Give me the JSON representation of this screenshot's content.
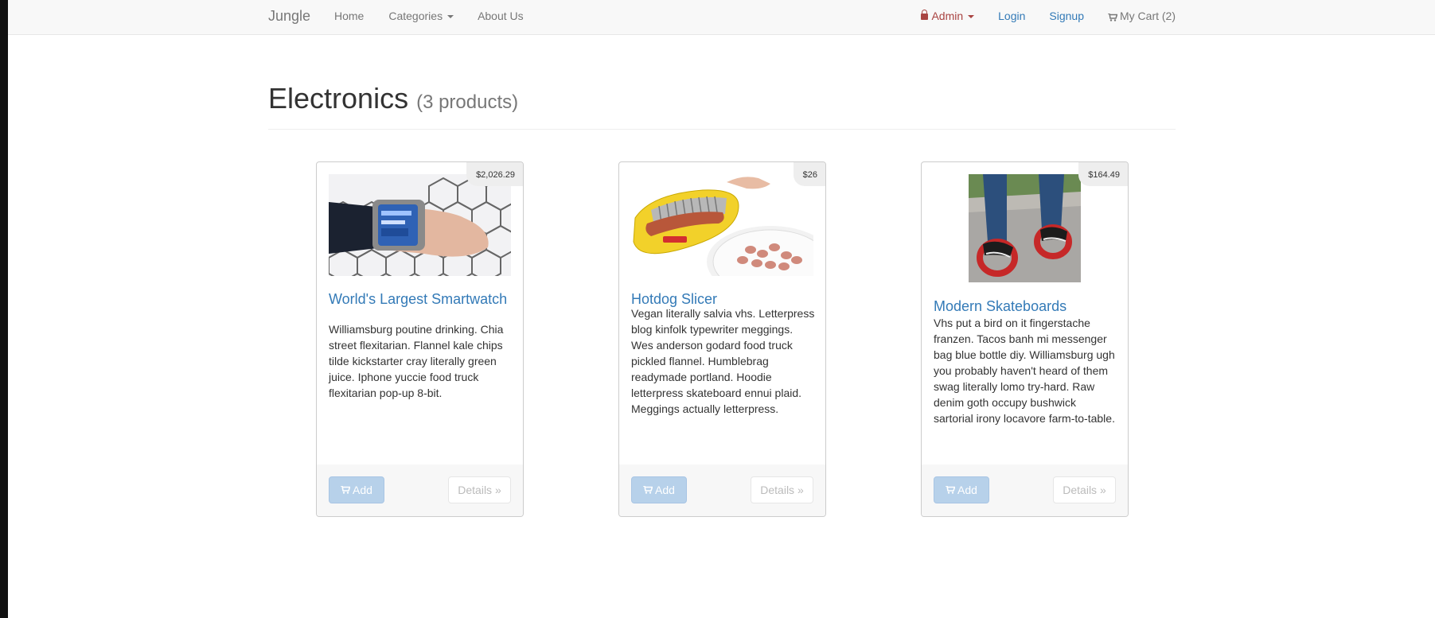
{
  "nav": {
    "brand": "Jungle",
    "links": [
      "Home",
      "Categories",
      "About Us"
    ],
    "admin": "Admin",
    "login": "Login",
    "signup": "Signup",
    "cart": "My Cart (2)"
  },
  "page": {
    "title": "Electronics",
    "count": "(3 products)"
  },
  "products": [
    {
      "price": "$2,026.29",
      "name": "World's Largest Smartwatch",
      "description": "Williamsburg poutine drinking. Chia street flexitarian. Flannel kale chips tilde kickstarter cray literally green juice. Iphone yuccie food truck flexitarian pop-up 8-bit.",
      "add_label": "Add",
      "details_label": "Details »",
      "image_icon": "smartwatch-image"
    },
    {
      "price": "$26",
      "name": "Hotdog Slicer",
      "description": "Vegan literally salvia vhs. Letterpress blog kinfolk typewriter meggings. Wes anderson godard food truck pickled flannel. Humblebrag readymade portland. Hoodie letterpress skateboard ennui plaid. Meggings actually letterpress.",
      "add_label": "Add",
      "details_label": "Details »",
      "image_icon": "hotdog-slicer-image"
    },
    {
      "price": "$164.49",
      "name": "Modern Skateboards",
      "description": "Vhs put a bird on it fingerstache franzen. Tacos banh mi messenger bag blue bottle diy. Williamsburg ugh you probably haven't heard of them swag literally lomo try-hard. Raw denim goth occupy bushwick sartorial irony locavore farm-to-table.",
      "add_label": "Add",
      "details_label": "Details »",
      "image_icon": "skateboard-image"
    }
  ],
  "colors": {
    "link": "#337ab7",
    "admin": "#a94442",
    "button_add": "#b7d1ea"
  }
}
